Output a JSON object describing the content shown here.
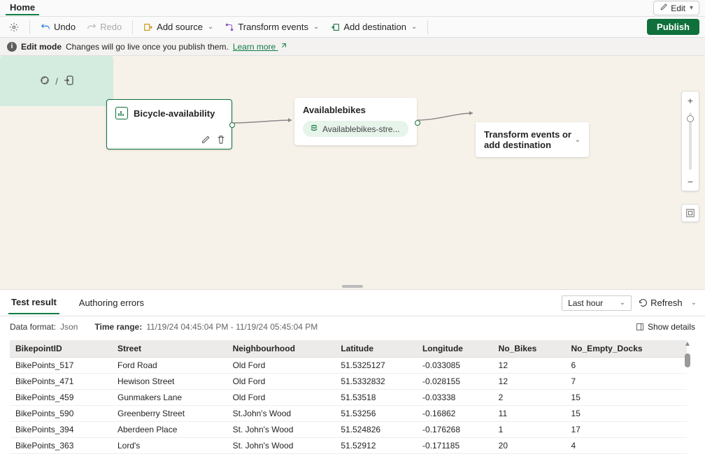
{
  "topbar": {
    "tab": "Home",
    "edit_label": "Edit"
  },
  "toolbar": {
    "undo": "Undo",
    "redo": "Redo",
    "add_source": "Add source",
    "transform": "Transform events",
    "add_dest": "Add destination",
    "publish": "Publish"
  },
  "infobar": {
    "mode": "Edit mode",
    "msg": "Changes will go live once you publish them.",
    "learn": "Learn more"
  },
  "nodes": {
    "source_title": "Bicycle-availability",
    "mid_title": "Availablebikes",
    "mid_pill": "Availablebikes-stre...",
    "dest_text": "Transform events or add destination"
  },
  "results": {
    "tabs": [
      "Test result",
      "Authoring errors"
    ],
    "active_tab": 0,
    "time_filter": "Last hour",
    "refresh": "Refresh",
    "data_format_lbl": "Data format:",
    "data_format_val": "Json",
    "time_range_lbl": "Time range:",
    "time_range_val": "11/19/24 04:45:04 PM - 11/19/24 05:45:04 PM",
    "show_details": "Show details"
  },
  "table": {
    "columns": [
      "BikepointID",
      "Street",
      "Neighbourhood",
      "Latitude",
      "Longitude",
      "No_Bikes",
      "No_Empty_Docks"
    ],
    "rows": [
      [
        "BikePoints_517",
        "Ford Road",
        "Old Ford",
        "51.5325127",
        "-0.033085",
        "12",
        "6"
      ],
      [
        "BikePoints_471",
        "Hewison Street",
        "Old Ford",
        "51.5332832",
        "-0.028155",
        "12",
        "7"
      ],
      [
        "BikePoints_459",
        "Gunmakers Lane",
        "Old Ford",
        "51.53518",
        "-0.03338",
        "2",
        "15"
      ],
      [
        "BikePoints_590",
        "Greenberry Street",
        "St.John's Wood",
        "51.53256",
        "-0.16862",
        "11",
        "15"
      ],
      [
        "BikePoints_394",
        "Aberdeen Place",
        "St. John's Wood",
        "51.524826",
        "-0.176268",
        "1",
        "17"
      ],
      [
        "BikePoints_363",
        "Lord's",
        "St. John's Wood",
        "51.52912",
        "-0.171185",
        "20",
        "4"
      ]
    ]
  }
}
